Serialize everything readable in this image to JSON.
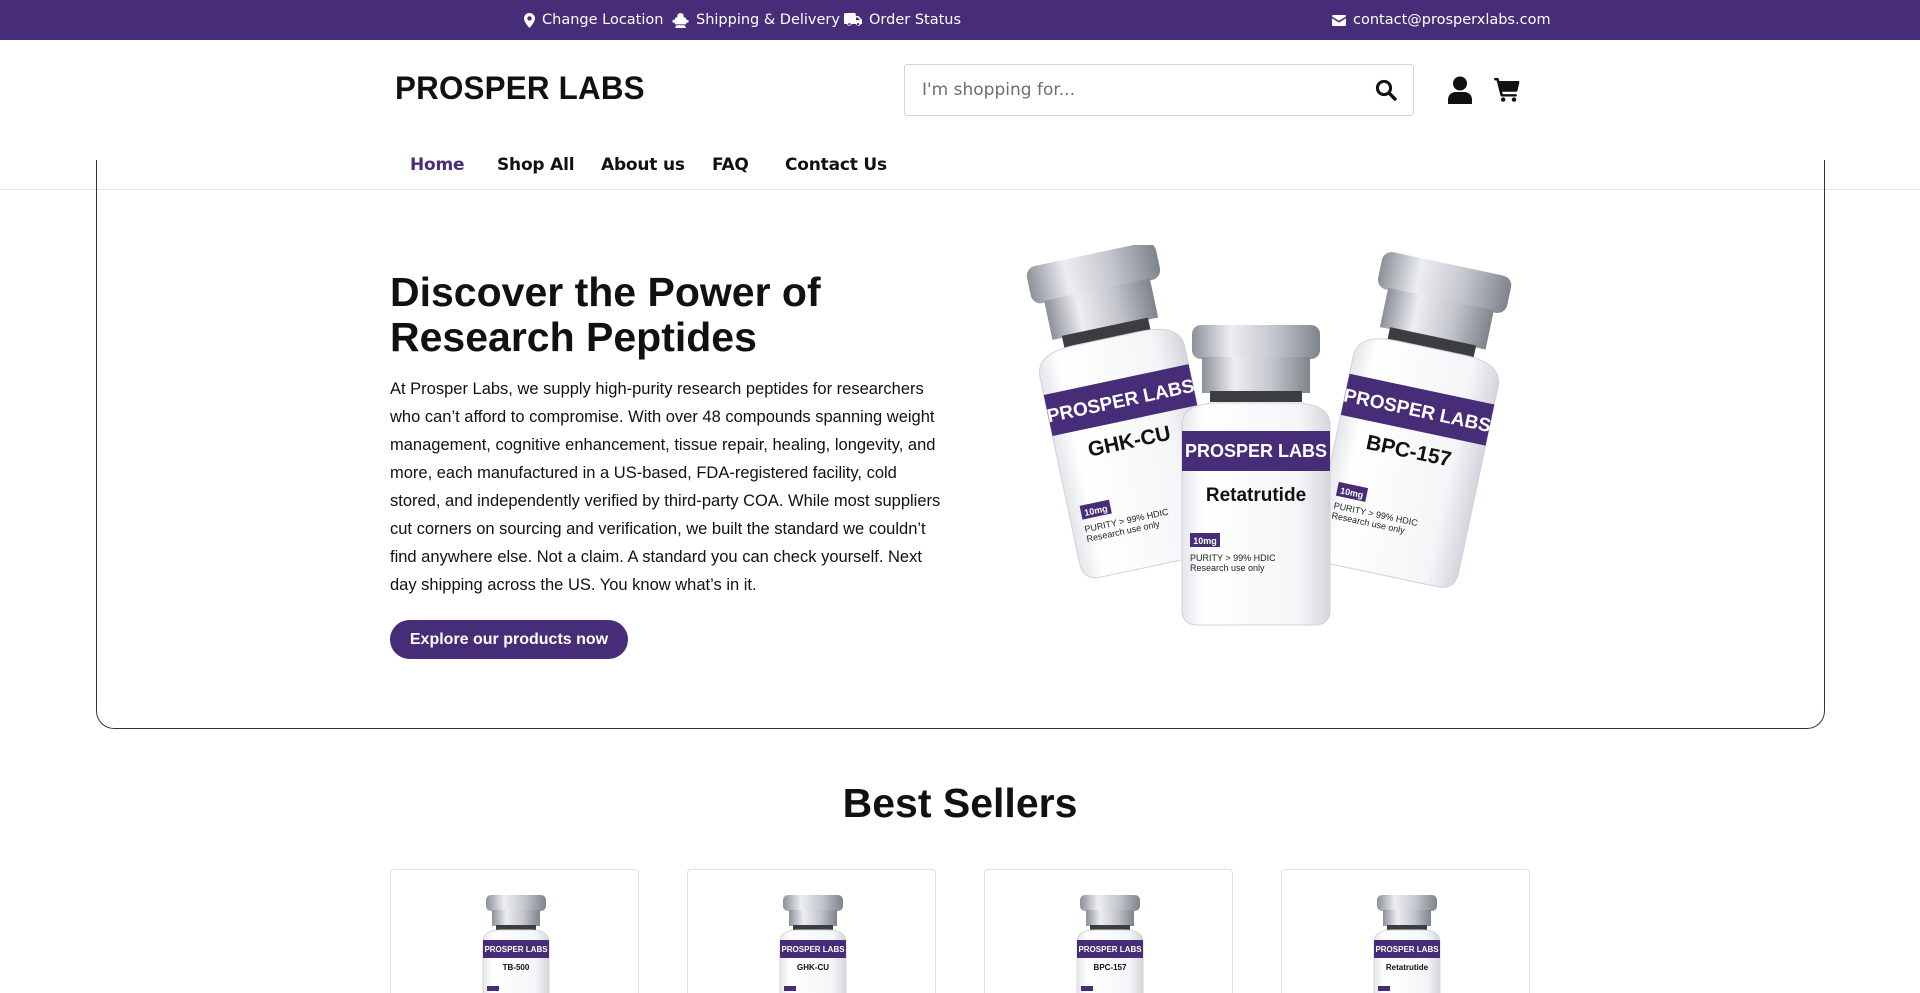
{
  "topbar": {
    "change_location": "Change Location",
    "shipping": "Shipping & Delivery",
    "order_status": "Order Status",
    "email": "contact@prosperxlabs.com"
  },
  "header": {
    "logo": "PROSPER LABS",
    "search_placeholder": "I'm shopping for..."
  },
  "nav": {
    "items": [
      "Home",
      "Shop All",
      "About us",
      "FAQ",
      "Contact Us"
    ],
    "active": "Home"
  },
  "hero": {
    "title": "Discover the Power of Research Peptides",
    "text": "At Prosper Labs, we supply high-purity research peptides for researchers who can’t afford to compromise. With over 48 compounds spanning weight management, cognitive enhancement, tissue repair, healing, longevity, and more, each manufactured in a US-based, FDA-registered facility, cold stored, and independently verified by third-party COA. While most suppliers cut corners on sourcing and verification, we built the standard we couldn’t find anywhere else. Not a claim. A standard you can check yourself. Next day shipping across the US. You know what’s in it.",
    "button": "Explore our products now",
    "vials": [
      {
        "brand": "PROSPER LABS",
        "name": "GHK-CU",
        "dose": "10mg",
        "line1": "PURITY > 99% HDIC",
        "line2": "Research use only"
      },
      {
        "brand": "PROSPER LABS",
        "name": "Retatrutide",
        "dose": "10mg",
        "line1": "PURITY > 99% HDIC",
        "line2": "Research use only"
      },
      {
        "brand": "PROSPER LABS",
        "name": "BPC-157",
        "dose": "10mg",
        "line1": "PURITY > 99% HDIC",
        "line2": "Research use only"
      }
    ]
  },
  "best_sellers": {
    "title": "Best Sellers",
    "products": [
      {
        "brand": "PROSPER LABS",
        "name": "TB-500"
      },
      {
        "brand": "PROSPER LABS",
        "name": "GHK-CU"
      },
      {
        "brand": "PROSPER LABS",
        "name": "BPC-157"
      },
      {
        "brand": "PROSPER LABS",
        "name": "Retatrutide"
      }
    ]
  },
  "colors": {
    "brand_purple": "#472d77",
    "text": "#111111",
    "border": "#e0e0e0"
  },
  "icons": {
    "location": "map-marker-icon",
    "shipping": "shipping-icon",
    "truck": "truck-icon",
    "email": "envelope-icon",
    "search": "search-icon",
    "user": "user-icon",
    "cart": "cart-icon"
  }
}
